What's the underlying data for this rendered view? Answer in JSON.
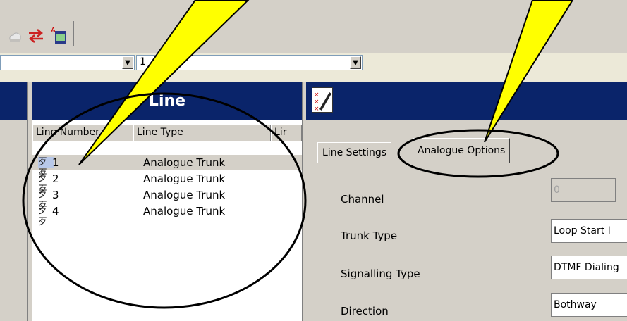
{
  "toolbar": {
    "icons": [
      "cloud-icon",
      "swap-arrows-icon",
      "text-edit-icon"
    ]
  },
  "combos": {
    "first": {
      "value": ""
    },
    "second": {
      "value": "1"
    }
  },
  "line_pane": {
    "title": "Line",
    "columns": [
      "Line Number",
      "Line Type",
      "Lir"
    ],
    "rows": [
      {
        "number": "1",
        "type": "Analogue Trunk",
        "selected": true
      },
      {
        "number": "2",
        "type": "Analogue Trunk",
        "selected": false
      },
      {
        "number": "3",
        "type": "Analogue Trunk",
        "selected": false
      },
      {
        "number": "4",
        "type": "Analogue Trunk",
        "selected": false
      }
    ]
  },
  "detail_pane": {
    "tabs": [
      "Line Settings",
      "Analogue Options"
    ],
    "active_tab": "Analogue Options",
    "fields": [
      {
        "label": "Channel",
        "value": "0",
        "disabled": true
      },
      {
        "label": "Trunk Type",
        "value": "Loop Start I"
      },
      {
        "label": "Signalling Type",
        "value": "DTMF Dialing"
      },
      {
        "label": "Direction",
        "value": "Bothway"
      }
    ]
  },
  "colors": {
    "title_bar": "#0a246a",
    "callout": "#ffff00",
    "window_bg": "#d4d0c8"
  }
}
